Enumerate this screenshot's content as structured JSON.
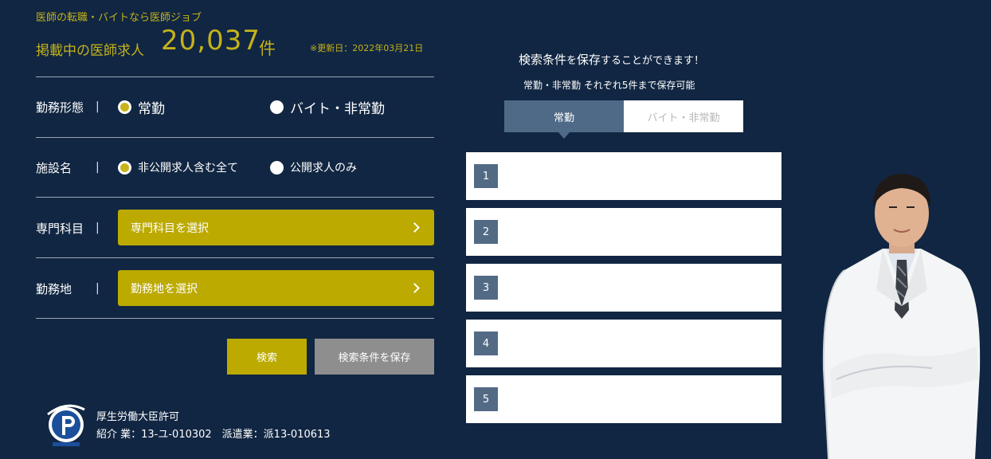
{
  "header": {
    "tagline": "医師の転職・バイトなら医師ジョブ",
    "count_label": "掲載中の医師求人",
    "count_value": "20,037",
    "count_unit": "件",
    "updated": "※更新日：2022年03月21日"
  },
  "form": {
    "employment": {
      "label": "勤務形態",
      "separator": "|",
      "options": [
        "常勤",
        "バイト・非常勤"
      ],
      "selected": "常勤"
    },
    "facility": {
      "label": "施設名",
      "separator": "|",
      "options": [
        "非公開求人含む全て",
        "公開求人のみ"
      ],
      "selected": "非公開求人含む全て"
    },
    "specialty": {
      "label": "専門科目",
      "separator": "|",
      "button": "専門科目を選択"
    },
    "location": {
      "label": "勤務地",
      "separator": "|",
      "button": "勤務地を選択"
    },
    "search_button": "検索",
    "save_button": "検索条件を保存"
  },
  "license": {
    "title": "厚生労働大臣許可",
    "numbers": "紹介 業：13-ユ-010302　派遣業：派13-010613"
  },
  "saved": {
    "title_a": "検索条件",
    "title_b": "を",
    "title_c": "保存",
    "title_d": "することができます！",
    "subtitle": "常勤・非常勤 それぞれ5件まで保存可能",
    "tabs": [
      "常勤",
      "バイト・非常勤"
    ],
    "active_tab": "常勤",
    "slots": [
      "1",
      "2",
      "3",
      "4",
      "5"
    ]
  },
  "colors": {
    "background": "#112642",
    "accent_gold": "#bcaa00",
    "tab_active": "#4f6a87",
    "slot_badge": "#536a85",
    "button_grey": "#8e8e8e"
  }
}
